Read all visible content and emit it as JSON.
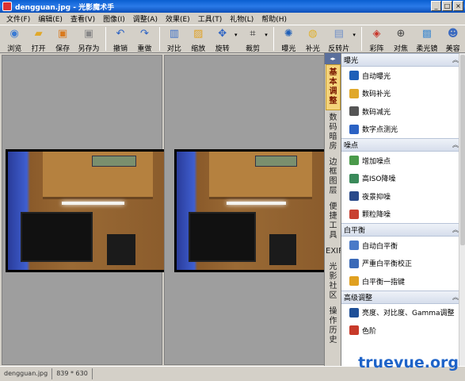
{
  "window": {
    "title": "dengguan.jpg - 光影魔术手",
    "min": "_",
    "max": "□",
    "close": "×"
  },
  "menu": [
    "文件(F)",
    "编辑(E)",
    "查看(V)",
    "图像(I)",
    "调整(A)",
    "效果(E)",
    "工具(T)",
    "礼物(L)",
    "帮助(H)"
  ],
  "toolbar": [
    {
      "label": "浏览",
      "icon": "browse-icon",
      "glyph": "◉",
      "color": "#3b7bd4"
    },
    {
      "label": "打开",
      "icon": "open-folder-icon",
      "glyph": "▰",
      "color": "#e0a82a"
    },
    {
      "label": "保存",
      "icon": "save-icon",
      "glyph": "▣",
      "color": "#d97a1e"
    },
    {
      "label": "另存为",
      "icon": "save-as-icon",
      "glyph": "▣",
      "color": "#888888"
    },
    {
      "label": "撤销",
      "icon": "undo-icon",
      "glyph": "↶",
      "color": "#2b62c4"
    },
    {
      "label": "重做",
      "icon": "redo-icon",
      "glyph": "↷",
      "color": "#2b62c4"
    },
    {
      "label": "对比",
      "icon": "compare-icon",
      "glyph": "▥",
      "color": "#3a6fc8"
    },
    {
      "label": "缩放",
      "icon": "zoom-icon",
      "glyph": "▨",
      "color": "#e0a020"
    },
    {
      "label": "旋转",
      "icon": "rotate-icon",
      "glyph": "✥",
      "color": "#2b62c4"
    },
    {
      "label": "裁剪",
      "icon": "crop-icon",
      "glyph": "⌗",
      "color": "#333333"
    },
    {
      "label": "曝光",
      "icon": "exposure-icon",
      "glyph": "✺",
      "color": "#1e5fb8"
    },
    {
      "label": "补光",
      "icon": "fill-light-icon",
      "glyph": "◍",
      "color": "#e0b02a"
    },
    {
      "label": "反转片",
      "icon": "reversal-film-icon",
      "glyph": "▤",
      "color": "#6f8fc8"
    },
    {
      "label": "彩阵",
      "icon": "color-matrix-icon",
      "glyph": "◈",
      "color": "#c8362b"
    },
    {
      "label": "对焦",
      "icon": "focus-icon",
      "glyph": "⊕",
      "color": "#444444"
    },
    {
      "label": "柔光镜",
      "icon": "soft-lens-icon",
      "glyph": "▩",
      "color": "#4a8fd0"
    },
    {
      "label": "美容",
      "icon": "beauty-icon",
      "glyph": "☻",
      "color": "#3b6ac0"
    }
  ],
  "vtabs": [
    "基本调整",
    "数码暗房",
    "边框图层",
    "便捷工具",
    "EXIF",
    "光影社区",
    "操作历史"
  ],
  "vtab_header": "◂▸",
  "sections": [
    {
      "title": "曝光",
      "chevron": "︽",
      "items": [
        {
          "label": "自动曝光",
          "icon": "auto-exposure-icon",
          "color": "#1e5fb8"
        },
        {
          "label": "数码补光",
          "icon": "digital-fill-icon",
          "color": "#e0a82a"
        },
        {
          "label": "数码减光",
          "icon": "digital-reduce-icon",
          "color": "#555555"
        },
        {
          "label": "数字点测光",
          "icon": "spot-meter-icon",
          "color": "#2b62c4"
        }
      ]
    },
    {
      "title": "噪点",
      "chevron": "︽",
      "items": [
        {
          "label": "增加噪点",
          "icon": "add-noise-icon",
          "color": "#4a9a4a"
        },
        {
          "label": "高ISO降噪",
          "icon": "iso-denoise-icon",
          "color": "#3a8a5a"
        },
        {
          "label": "夜景抑噪",
          "icon": "night-denoise-icon",
          "color": "#2a4a8a"
        },
        {
          "label": "颗粒降噪",
          "icon": "grain-denoise-icon",
          "color": "#c84030"
        }
      ]
    },
    {
      "title": "白平衡",
      "chevron": "︽",
      "items": [
        {
          "label": "自动白平衡",
          "icon": "auto-wb-icon",
          "color": "#4a7ac8"
        },
        {
          "label": "严重白平衡校正",
          "icon": "wb-correct-icon",
          "color": "#3a6ab8"
        },
        {
          "label": "白平衡一指键",
          "icon": "wb-one-touch-icon",
          "color": "#e0a020"
        }
      ]
    },
    {
      "title": "高级调整",
      "chevron": "︽",
      "items": [
        {
          "label": "亮度、对比度、Gamma调整",
          "icon": "brightness-contrast-icon",
          "color": "#1e4f98"
        },
        {
          "label": "色阶",
          "icon": "levels-icon",
          "color": "#c83a2a"
        }
      ]
    }
  ],
  "status": {
    "filename": "dengguan.jpg",
    "size": "839 * 630"
  },
  "watermark": "truevue.org"
}
